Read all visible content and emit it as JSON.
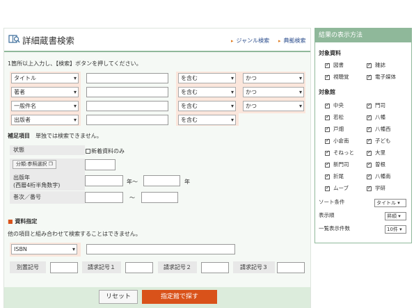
{
  "header": {
    "title": "詳細蔵書検索",
    "link1": "ジャンル検索",
    "link2": "典拠検索"
  },
  "note": "1箇所以上入力し、【検索】ボタンを押してください。",
  "fields": [
    {
      "field": "タイトル",
      "cond": "を含む",
      "op": "かつ"
    },
    {
      "field": "著者",
      "cond": "を含む",
      "op": "かつ"
    },
    {
      "field": "一般件名",
      "cond": "を含む",
      "op": "かつ"
    },
    {
      "field": "出版者",
      "cond": "を含む",
      "op": ""
    }
  ],
  "supp": {
    "heading": "補足項目",
    "sub": "単独では検索できません。",
    "status_label": "状態",
    "status_check": "新着資料のみ",
    "class_button": "分類:参照選択",
    "year_label": "出版年\n(西暦4桁半角数字)",
    "year_from": "年～",
    "year_to": "年",
    "vol_label": "巻次／番号",
    "vol_sep": "～"
  },
  "material": {
    "heading": "資料指定",
    "note": "他の項目と組み合わせて検索することはできません。",
    "id_type": "ISBN",
    "separate_label": "別置記号",
    "call1": "請求記号１",
    "call2": "請求記号２",
    "call3": "請求記号３"
  },
  "footer": {
    "reset": "リセット",
    "search": "指定館で探す"
  },
  "side": {
    "title": "結果の表示方法",
    "materials_heading": "対象資料",
    "materials": [
      "図書",
      "雑誌",
      "視聴覚",
      "電子媒体"
    ],
    "libraries_heading": "対象館",
    "libraries": [
      "中央",
      "門司",
      "若松",
      "八幡",
      "戸畑",
      "八幡西",
      "小倉南",
      "子ども",
      "そねっと",
      "大里",
      "新門司",
      "曽根",
      "折尾",
      "八幡南",
      "ムーブ",
      "学研"
    ],
    "sort_label": "ソート条件",
    "sort_value": "タイトル",
    "order_label": "表示順",
    "order_value": "昇順",
    "count_label": "一覧表示件数",
    "count_value": "10件"
  }
}
